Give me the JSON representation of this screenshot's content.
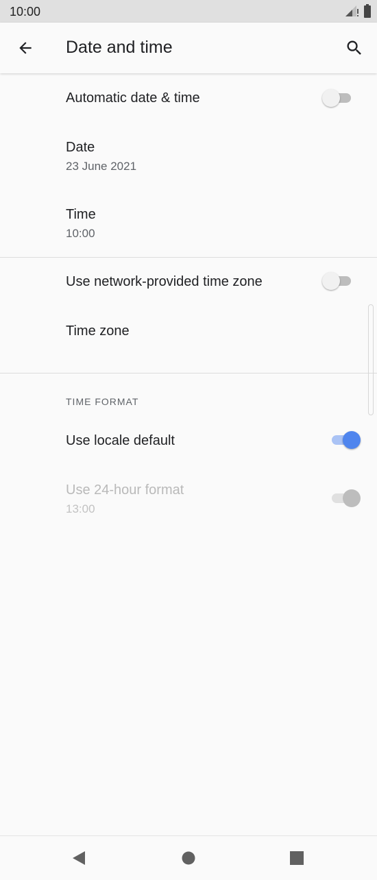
{
  "status_bar": {
    "time": "10:00"
  },
  "app_bar": {
    "title": "Date and time"
  },
  "settings": {
    "automatic_date_time": {
      "label": "Automatic date & time",
      "enabled": false
    },
    "date": {
      "label": "Date",
      "value": "23 June 2021"
    },
    "time": {
      "label": "Time",
      "value": "10:00"
    },
    "network_time_zone": {
      "label": "Use network-provided time zone",
      "enabled": false
    },
    "time_zone": {
      "label": "Time zone"
    },
    "time_format_header": "TIME FORMAT",
    "use_locale_default": {
      "label": "Use locale default",
      "enabled": true
    },
    "use_24_hour": {
      "label": "Use 24-hour format",
      "value": "13:00",
      "enabled": true,
      "disabled": true
    }
  },
  "colors": {
    "accent": "#4f85ee",
    "background": "#fafafa",
    "status_bar": "#e0e0e0"
  }
}
